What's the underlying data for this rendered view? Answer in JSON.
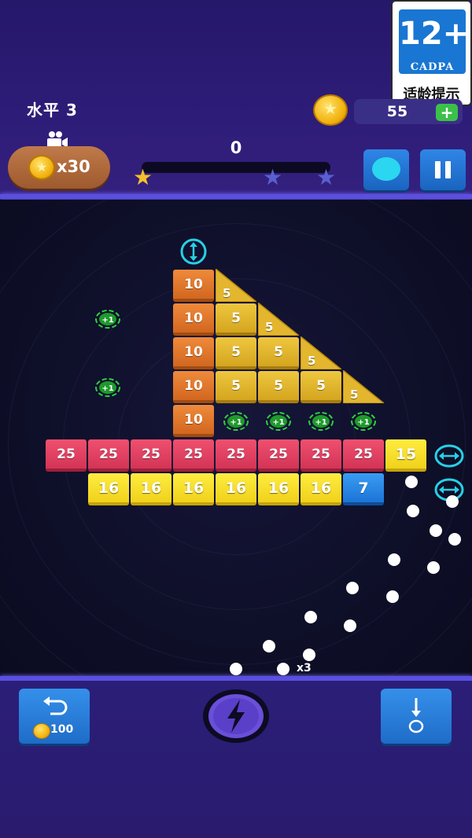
{
  "age_rating": {
    "number": "12+",
    "org": "CADPA",
    "label": "适龄提示"
  },
  "header": {
    "level_label": "水平 3",
    "coins": "55",
    "video_reward": "x30",
    "score": "0",
    "stars_earned": 1,
    "stars_total": 3
  },
  "colors": {
    "accent_blue": "#2f86e6",
    "brick_orange": "#ef8a3b",
    "brick_gold": "#eec73f",
    "brick_pink": "#f0506f",
    "brick_yellow": "#ffec40",
    "brick_blue": "#3a9cf3",
    "star_gold": "#f7c02a",
    "star_empty": "#5a5fd0"
  },
  "bricks": {
    "orange": [
      "10",
      "10",
      "10",
      "10",
      "10"
    ],
    "gold_squares": [
      "5",
      "5",
      "5",
      "5",
      "5",
      "5"
    ],
    "gold_triangles": [
      "5",
      "5",
      "5",
      "5"
    ],
    "pink": [
      "25",
      "25",
      "25",
      "25",
      "25",
      "25",
      "25",
      "25"
    ],
    "yellow_15": "15",
    "yellow_16": [
      "16",
      "16",
      "16",
      "16",
      "16",
      "16"
    ],
    "blue": "7"
  },
  "powerups": {
    "plus_one": "+1"
  },
  "balls": {
    "count_label": "x3"
  },
  "controls": {
    "undo_cost": "100"
  },
  "icons": [
    "video-camera-icon",
    "coin-icon",
    "plus-icon",
    "star-icon",
    "pause-icon",
    "vertical-arrow-icon",
    "horizontal-arrow-icon",
    "undo-arrow-icon",
    "lightning-icon",
    "drop-arrow-icon"
  ]
}
